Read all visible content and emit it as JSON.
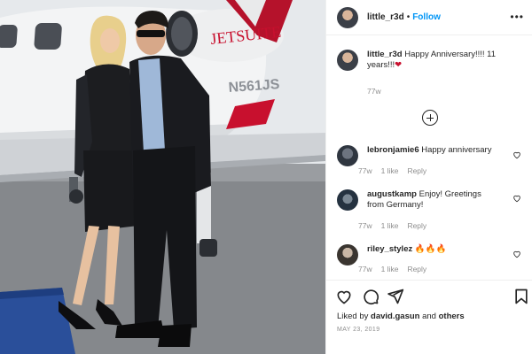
{
  "post": {
    "username": "little_r3d",
    "follow_label": "Follow",
    "more_icon": "more-icon",
    "caption": {
      "username": "little_r3d",
      "text": "Happy Anniversary!!!! 11 years!!!",
      "emoji": "❤",
      "time": "77w"
    },
    "load_more_icon": "plus-circle-icon",
    "comments": [
      {
        "username": "lebronjamie6",
        "text": "Happy anniversary",
        "time": "77w",
        "likes": "1 like",
        "reply": "Reply"
      },
      {
        "username": "augustkamp",
        "text": "Enjoy! Greetings from Germany!",
        "time": "77w",
        "likes": "1 like",
        "reply": "Reply"
      },
      {
        "username": "riley_stylez",
        "text": "🔥🔥🔥",
        "time": "77w",
        "likes": "1 like",
        "reply": "Reply"
      }
    ],
    "liked_prefix": "Liked by",
    "liked_user": "david.gasun",
    "liked_and": "and",
    "liked_others": "others",
    "date": "MAY 23, 2019",
    "photo": {
      "jet_brand": "JETSUITE",
      "tail_number": "N561JS"
    },
    "colors": {
      "follow": "#0095f6",
      "text": "#262626",
      "muted": "#8e8e8e",
      "jet_red": "#c8102e"
    }
  }
}
